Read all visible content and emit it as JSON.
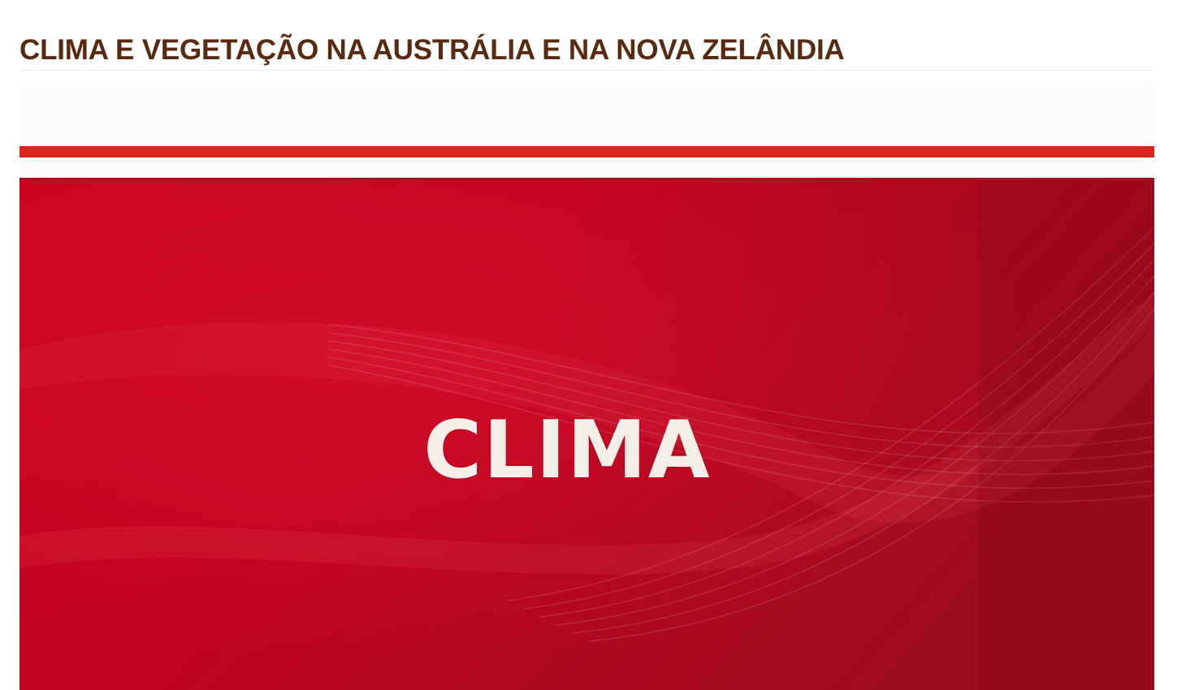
{
  "page": {
    "title": "CLIMA E VEGETAÇÃO NA AUSTRÁLIA E NA NOVA ZELÂNDIA",
    "title_color": "#5a2a10"
  },
  "media": {
    "label": "CLIMA",
    "background_color": "#c4001c",
    "stripe_color": "#d9261c"
  }
}
